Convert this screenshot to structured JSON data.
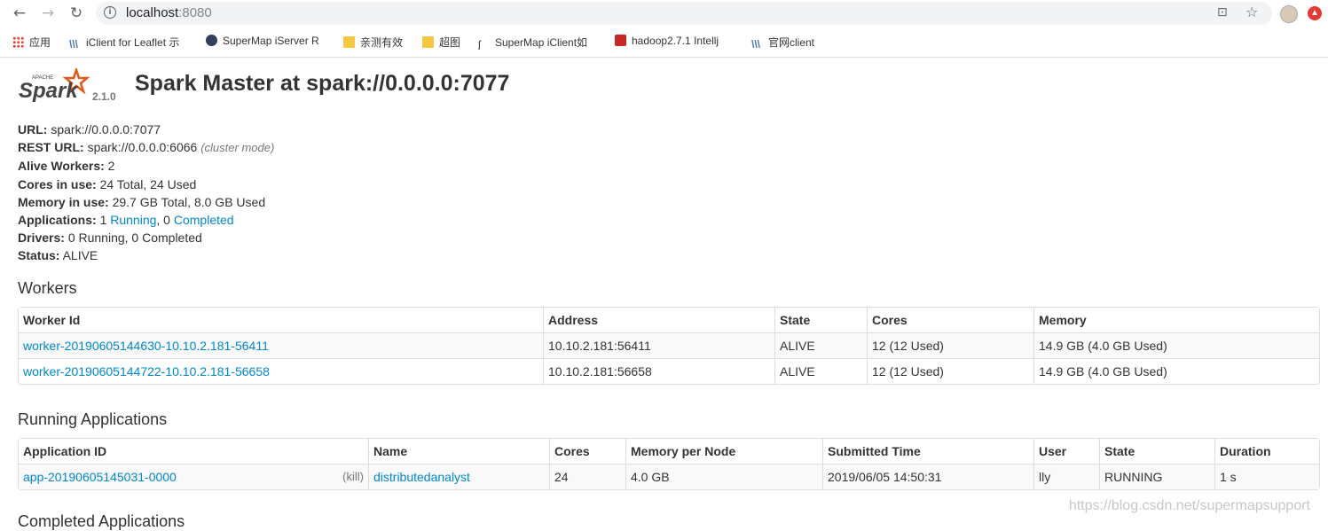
{
  "browser": {
    "url_host": "localhost",
    "url_port": ":8080",
    "bookmarks": [
      {
        "icon": "apps-grid-icon",
        "label": "应用"
      },
      {
        "icon": "wave-icon",
        "label": "iClient for Leaflet 示"
      },
      {
        "icon": "globe-icon",
        "label": "SuperMap iServer R"
      },
      {
        "icon": "folder-icon",
        "label": "亲测有效"
      },
      {
        "icon": "folder-icon",
        "label": "超图"
      },
      {
        "icon": "script-icon",
        "label": "SuperMap iClient如"
      },
      {
        "icon": "csdn-icon",
        "label": "hadoop2.7.1 Intellj"
      },
      {
        "icon": "wave-icon",
        "label": "官网client"
      }
    ]
  },
  "header": {
    "logo_text": "Spark",
    "logo_apache": "APACHE",
    "version": "2.1.0",
    "title": "Spark Master at spark://0.0.0.0:7077"
  },
  "summary": {
    "url_label": "URL:",
    "url_value": "spark://0.0.0.0:7077",
    "rest_label": "REST URL:",
    "rest_value": "spark://0.0.0.0:6066",
    "rest_mode": "(cluster mode)",
    "alive_label": "Alive Workers:",
    "alive_value": "2",
    "cores_label": "Cores in use:",
    "cores_value": "24 Total, 24 Used",
    "memory_label": "Memory in use:",
    "memory_value": "29.7 GB Total, 8.0 GB Used",
    "apps_label": "Applications:",
    "apps_running_count": "1",
    "apps_running_link": "Running",
    "apps_sep": ", 0",
    "apps_completed_link": "Completed",
    "drivers_label": "Drivers:",
    "drivers_value": "0 Running, 0 Completed",
    "status_label": "Status:",
    "status_value": "ALIVE"
  },
  "workers": {
    "title": "Workers",
    "columns": [
      "Worker Id",
      "Address",
      "State",
      "Cores",
      "Memory"
    ],
    "rows": [
      [
        "worker-20190605144630-10.10.2.181-56411",
        "10.10.2.181:56411",
        "ALIVE",
        "12 (12 Used)",
        "14.9 GB (4.0 GB Used)"
      ],
      [
        "worker-20190605144722-10.10.2.181-56658",
        "10.10.2.181:56658",
        "ALIVE",
        "12 (12 Used)",
        "14.9 GB (4.0 GB Used)"
      ]
    ]
  },
  "running_apps": {
    "title": "Running Applications",
    "columns": [
      "Application ID",
      "Name",
      "Cores",
      "Memory per Node",
      "Submitted Time",
      "User",
      "State",
      "Duration"
    ],
    "rows": [
      [
        "app-20190605145031-0000",
        "distributedanalyst",
        "24",
        "4.0 GB",
        "2019/06/05 14:50:31",
        "lly",
        "RUNNING",
        "1 s"
      ]
    ],
    "kill_label": "(kill)"
  },
  "completed_apps": {
    "title": "Completed Applications"
  },
  "watermark": "https://blog.csdn.net/supermapsupport"
}
